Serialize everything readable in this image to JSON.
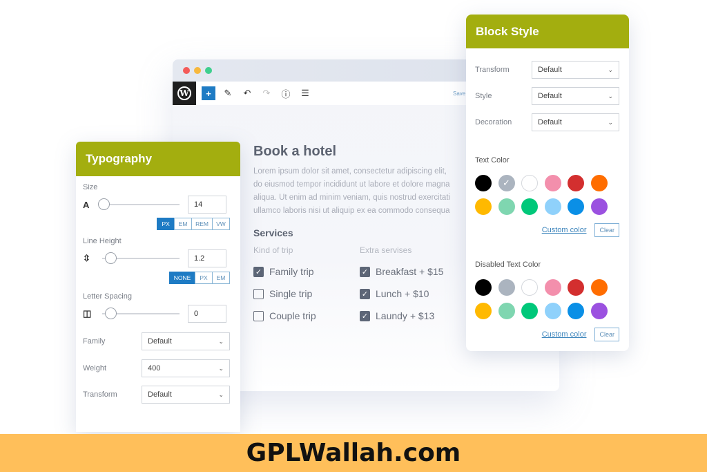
{
  "editor": {
    "window_dots": [
      "#f45b59",
      "#f7b83d",
      "#3ecf8e"
    ],
    "toolbar": {
      "logo": "W",
      "add_icon": "+",
      "edit_icon": "✎",
      "undo_icon": "↶",
      "redo_icon": "↷",
      "info_icon": "ⓘ",
      "list_icon": "☰",
      "save_label": "Save"
    },
    "heading": "Book a hotel",
    "lorem": [
      "Lorem ipsum dolor sit amet, consectetur adipiscing elit,",
      "do eiusmod tempor incididunt ut labore et dolore magna",
      "aliqua. Ut enim ad minim veniam, quis nostrud exercitati",
      "ullamco laboris nisi ut aliquip ex ea commodo consequa"
    ],
    "services_title": "Services",
    "kind_of_trip": {
      "header": "Kind of trip",
      "items": [
        {
          "label": "Family trip",
          "checked": true
        },
        {
          "label": "Single trip",
          "checked": false
        },
        {
          "label": "Couple trip",
          "checked": false
        }
      ]
    },
    "extra_services": {
      "header": "Extra servises",
      "items": [
        {
          "label": "Breakfast + $15",
          "checked": true
        },
        {
          "label": "Lunch + $10",
          "checked": true
        },
        {
          "label": "Laundy + $13",
          "checked": true
        }
      ]
    }
  },
  "typography": {
    "title": "Typography",
    "size": {
      "label": "Size",
      "icon": "A",
      "value": "14",
      "units": [
        "PX",
        "EM",
        "REM",
        "VW"
      ],
      "active_unit": "PX"
    },
    "line_height": {
      "label": "Line Height",
      "icon": "⇳",
      "value": "1.2",
      "units": [
        "NONE",
        "PX",
        "EM"
      ],
      "active_unit": "NONE"
    },
    "letter_spacing": {
      "label": "Letter Spacing",
      "icon": "◫",
      "value": "0"
    },
    "family": {
      "label": "Family",
      "value": "Default"
    },
    "weight": {
      "label": "Weight",
      "value": "400"
    },
    "transform": {
      "label": "Transform",
      "value": "Default"
    }
  },
  "block_style": {
    "title": "Block Style",
    "transform": {
      "label": "Transform",
      "value": "Default"
    },
    "style": {
      "label": "Style",
      "value": "Default"
    },
    "decoration": {
      "label": "Decoration",
      "value": "Default"
    },
    "text_color": {
      "label": "Text Color",
      "selected_index": 1,
      "colors": [
        "#000000",
        "#abb4bf",
        "#ffffff",
        "#f38fac",
        "#d32f2f",
        "#ff6d00",
        "#ffb900",
        "#7fd6b0",
        "#00c87a",
        "#8fd1fb",
        "#0a8fe6",
        "#9b51e0"
      ],
      "custom_label": "Custom color",
      "clear_label": "Clear"
    },
    "disabled_text_color": {
      "label": "Disabled Text Color",
      "colors": [
        "#000000",
        "#abb4bf",
        "#ffffff",
        "#f38fac",
        "#d32f2f",
        "#ff6d00",
        "#ffb900",
        "#7fd6b0",
        "#00c87a",
        "#8fd1fb",
        "#0a8fe6",
        "#9b51e0"
      ],
      "custom_label": "Custom color",
      "clear_label": "Clear"
    }
  },
  "footer": {
    "text": "GPLWallah.com"
  },
  "colors": {
    "panel_header": "#a3ae0f",
    "accent_blue": "#1e7bc4",
    "footer_bg": "#ffbf5a"
  }
}
